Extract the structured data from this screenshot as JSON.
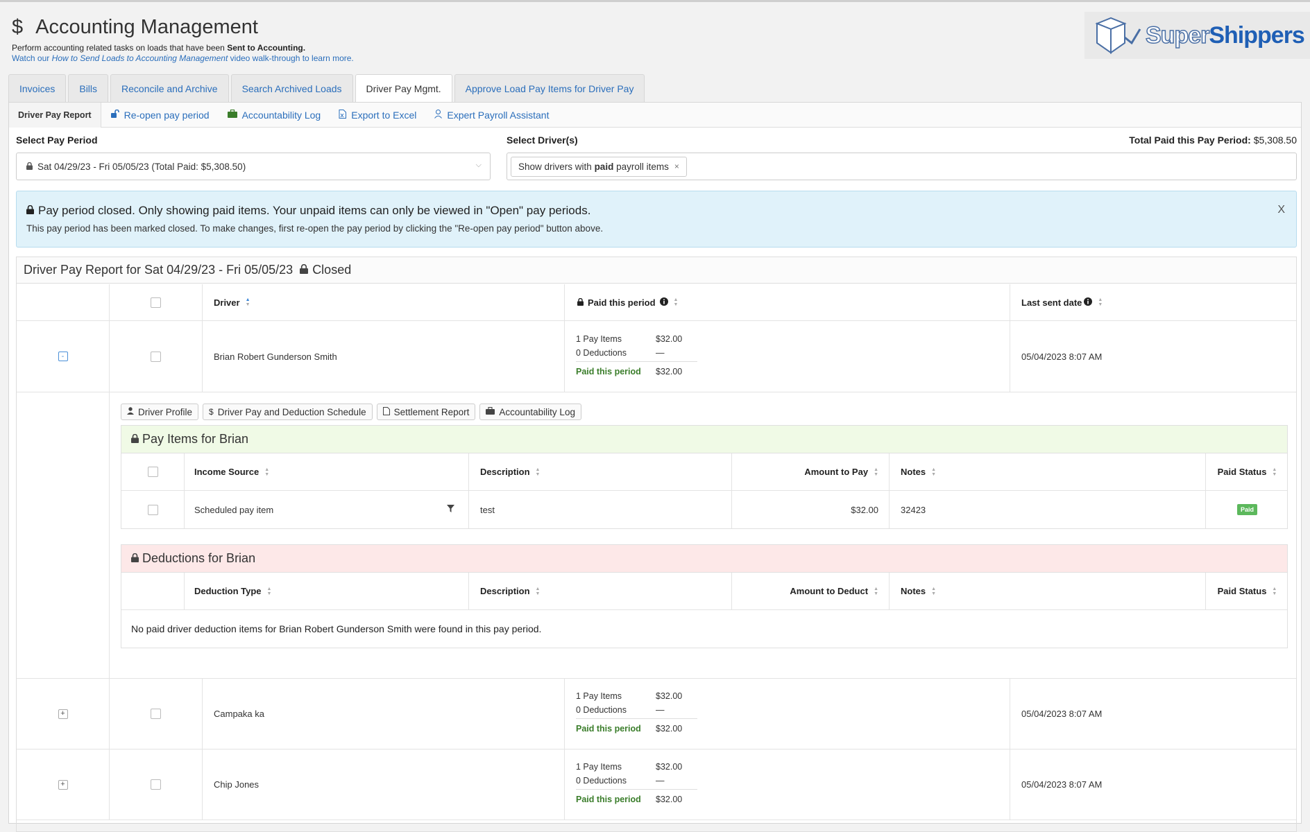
{
  "header": {
    "title": "Accounting Management",
    "subtitle_prefix": "Perform accounting related tasks on loads that have been",
    "subtitle_bold": "Sent to Accounting.",
    "walkthrough_prefix": "Watch our",
    "walkthrough_link": "How to Send Loads to Accounting Management",
    "walkthrough_suffix": "video walk-through to learn more."
  },
  "logo": {
    "super": "Super",
    "shippers": "Shippers"
  },
  "tabs": [
    {
      "label": "Invoices"
    },
    {
      "label": "Bills"
    },
    {
      "label": "Reconcile and Archive"
    },
    {
      "label": "Search Archived Loads"
    },
    {
      "label": "Driver Pay Mgmt.",
      "active": true
    },
    {
      "label": "Approve Load Pay Items for Driver Pay"
    }
  ],
  "subnav": {
    "active": "Driver Pay Report",
    "reopen": "Re-open pay period",
    "accountability": "Accountability Log",
    "export": "Export to Excel",
    "assistant": "Expert Payroll Assistant"
  },
  "selectors": {
    "pay_period_label": "Select Pay Period",
    "pay_period_value": "Sat 04/29/23 - Fri 05/05/23 (Total Paid: $5,308.50)",
    "drivers_label": "Select Driver(s)",
    "chip_prefix": "Show drivers with",
    "chip_bold": "paid",
    "chip_suffix": "payroll items",
    "total_label": "Total Paid this Pay Period:",
    "total_value": "$5,308.50"
  },
  "alert": {
    "heading": "Pay period closed. Only showing paid items. Your unpaid items can only be viewed in \"Open\" pay periods.",
    "body": "This pay period has been marked closed. To make changes, first re-open the pay period by clicking the \"Re-open pay period\" button above.",
    "close": "X"
  },
  "report": {
    "title": "Driver Pay Report for Sat 04/29/23 - Fri 05/05/23",
    "status": "Closed",
    "columns": {
      "driver": "Driver",
      "paid": "Paid this period",
      "last_sent": "Last sent date"
    },
    "drivers": [
      {
        "name": "Brian Robert Gunderson Smith",
        "pay_items": "1 Pay Items",
        "pay_amt": "$32.00",
        "deductions": "0 Deductions",
        "ded_amt": "—",
        "paid_label": "Paid this period",
        "paid_amt": "$32.00",
        "last_sent": "05/04/2023 8:07 AM",
        "toggle": "-"
      },
      {
        "name": "Campaka ka",
        "pay_items": "1 Pay Items",
        "pay_amt": "$32.00",
        "deductions": "0 Deductions",
        "ded_amt": "—",
        "paid_label": "Paid this period",
        "paid_amt": "$32.00",
        "last_sent": "05/04/2023 8:07 AM",
        "toggle": "+"
      },
      {
        "name": "Chip Jones",
        "pay_items": "1 Pay Items",
        "pay_amt": "$32.00",
        "deductions": "0 Deductions",
        "ded_amt": "—",
        "paid_label": "Paid this period",
        "paid_amt": "$32.00",
        "last_sent": "05/04/2023 8:07 AM",
        "toggle": "+"
      }
    ]
  },
  "expanded": {
    "buttons": {
      "profile": "Driver Profile",
      "schedule": "Driver Pay and Deduction Schedule",
      "settlement": "Settlement Report",
      "accountability": "Accountability Log"
    },
    "pay_items": {
      "title": "Pay Items for Brian",
      "columns": {
        "source": "Income Source",
        "description": "Description",
        "amount": "Amount to Pay",
        "notes": "Notes",
        "status": "Paid Status"
      },
      "rows": [
        {
          "source": "Scheduled pay item",
          "description": "test",
          "amount": "$32.00",
          "notes": "32423",
          "status": "Paid"
        }
      ]
    },
    "deductions": {
      "title": "Deductions for Brian",
      "columns": {
        "type": "Deduction Type",
        "description": "Description",
        "amount": "Amount to Deduct",
        "notes": "Notes",
        "status": "Paid Status"
      },
      "empty": "No paid driver deduction items for Brian Robert Gunderson Smith were found in this pay period."
    }
  }
}
